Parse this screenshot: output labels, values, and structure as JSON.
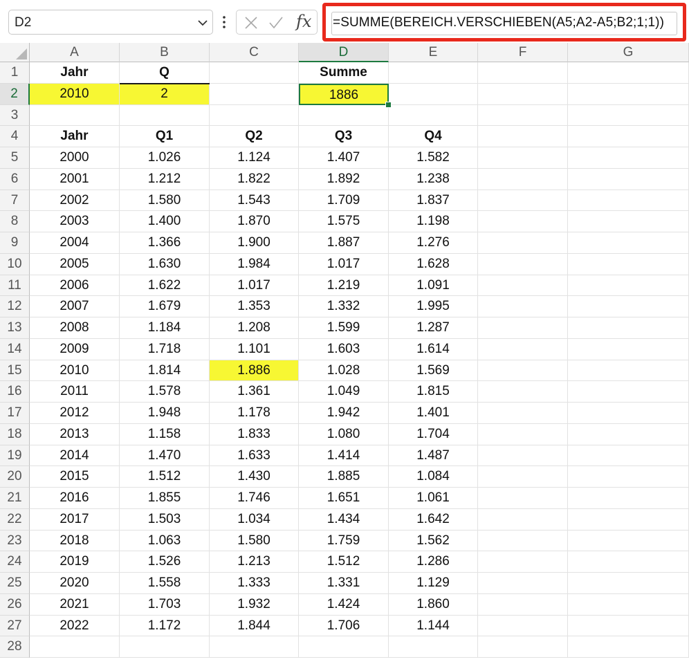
{
  "formula_bar": {
    "name_box": "D2",
    "cancel_icon": "x-icon",
    "enter_icon": "check-icon",
    "fx_label": "fx",
    "formula": "=SUMME(BEREICH.VERSCHIEBEN(A5;A2-A5;B2;1;1))"
  },
  "highlight_colors": {
    "formula_outline": "#e8291c",
    "yellow_fill": "#f7f733",
    "selection": "#1d7a3f"
  },
  "columns": [
    "A",
    "B",
    "C",
    "D",
    "E",
    "F",
    "G"
  ],
  "selected_cell": "D2",
  "rows": [
    [
      "Jahr",
      "Q",
      "",
      "Summe",
      "",
      "",
      ""
    ],
    [
      "2010",
      "2",
      "",
      "1886",
      "",
      "",
      ""
    ],
    [
      "",
      "",
      "",
      "",
      "",
      "",
      ""
    ],
    [
      "Jahr",
      "Q1",
      "Q2",
      "Q3",
      "Q4",
      "",
      ""
    ],
    [
      "2000",
      "1.026",
      "1.124",
      "1.407",
      "1.582",
      "",
      ""
    ],
    [
      "2001",
      "1.212",
      "1.822",
      "1.892",
      "1.238",
      "",
      ""
    ],
    [
      "2002",
      "1.580",
      "1.543",
      "1.709",
      "1.837",
      "",
      ""
    ],
    [
      "2003",
      "1.400",
      "1.870",
      "1.575",
      "1.198",
      "",
      ""
    ],
    [
      "2004",
      "1.366",
      "1.900",
      "1.887",
      "1.276",
      "",
      ""
    ],
    [
      "2005",
      "1.630",
      "1.984",
      "1.017",
      "1.628",
      "",
      ""
    ],
    [
      "2006",
      "1.622",
      "1.017",
      "1.219",
      "1.091",
      "",
      ""
    ],
    [
      "2007",
      "1.679",
      "1.353",
      "1.332",
      "1.995",
      "",
      ""
    ],
    [
      "2008",
      "1.184",
      "1.208",
      "1.599",
      "1.287",
      "",
      ""
    ],
    [
      "2009",
      "1.718",
      "1.101",
      "1.603",
      "1.614",
      "",
      ""
    ],
    [
      "2010",
      "1.814",
      "1.886",
      "1.028",
      "1.569",
      "",
      ""
    ],
    [
      "2011",
      "1.578",
      "1.361",
      "1.049",
      "1.815",
      "",
      ""
    ],
    [
      "2012",
      "1.948",
      "1.178",
      "1.942",
      "1.401",
      "",
      ""
    ],
    [
      "2013",
      "1.158",
      "1.833",
      "1.080",
      "1.704",
      "",
      ""
    ],
    [
      "2014",
      "1.470",
      "1.633",
      "1.414",
      "1.487",
      "",
      ""
    ],
    [
      "2015",
      "1.512",
      "1.430",
      "1.885",
      "1.084",
      "",
      ""
    ],
    [
      "2016",
      "1.855",
      "1.746",
      "1.651",
      "1.061",
      "",
      ""
    ],
    [
      "2017",
      "1.503",
      "1.034",
      "1.434",
      "1.642",
      "",
      ""
    ],
    [
      "2018",
      "1.063",
      "1.580",
      "1.759",
      "1.562",
      "",
      ""
    ],
    [
      "2019",
      "1.526",
      "1.213",
      "1.512",
      "1.286",
      "",
      ""
    ],
    [
      "2020",
      "1.558",
      "1.333",
      "1.331",
      "1.129",
      "",
      ""
    ],
    [
      "2021",
      "1.703",
      "1.932",
      "1.424",
      "1.860",
      "",
      ""
    ],
    [
      "2022",
      "1.172",
      "1.844",
      "1.706",
      "1.144",
      "",
      ""
    ],
    [
      "",
      "",
      "",
      "",
      "",
      "",
      ""
    ]
  ],
  "bold_cells": [
    "A1",
    "B1",
    "D1",
    "A4",
    "B4",
    "C4",
    "D4",
    "E4"
  ],
  "yellow_cells": [
    "A2",
    "B2",
    "D2",
    "C15"
  ]
}
